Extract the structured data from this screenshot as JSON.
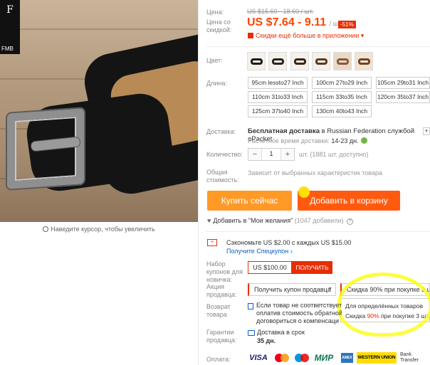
{
  "product_image": {
    "logo_text": "FMB",
    "zoom_hint": "Наведите курсор, чтобы увеличить"
  },
  "price": {
    "label": "Цена:",
    "old": "US $15.60 - 18.60 / шт.",
    "discount_label": "Цена со скидкой:",
    "new": "US $7.64 - 9.11",
    "unit": "/ шт.",
    "discount_badge": "-51%",
    "app_promo": "Скидки ещё больше в приложении"
  },
  "color": {
    "label": "Цвет:",
    "swatches": [
      {
        "name": "color-swatch-1",
        "belt": "#1c1c1c",
        "bg": "#f2efea"
      },
      {
        "name": "color-swatch-2",
        "belt": "#2a2320",
        "bg": "#efe9e0"
      },
      {
        "name": "color-swatch-3",
        "belt": "#3a2418",
        "bg": "#f0ebe4"
      },
      {
        "name": "color-swatch-4",
        "belt": "#5b3a22",
        "bg": "#f2ece4"
      },
      {
        "name": "color-swatch-5",
        "belt": "#8a5a36",
        "bg": "#ead9c8"
      },
      {
        "name": "color-swatch-6",
        "belt": "#6e4527",
        "bg": "#f1e2d2"
      }
    ]
  },
  "length": {
    "label": "Длина:",
    "options": [
      "95cm lessto27 Inch",
      "100cm 27to29 Inch",
      "105cm 29to31 Inch",
      "110cm 31to33 Inch",
      "115cm 33to35 Inch",
      "120cm 35to37 Inch",
      "125cm 37to40 Inch",
      "130cm 40to43 Inch"
    ]
  },
  "shipping": {
    "label": "Доставка:",
    "free": "Бесплатная доставка",
    "dest_prefix": "в",
    "destination": "Russian Federation",
    "service_prefix": "службой",
    "service": "ePacket",
    "eta_label": "Расчётное время доставки:",
    "eta_days": "14-23 дн."
  },
  "quantity": {
    "label": "Количество:",
    "minus": "−",
    "value": "1",
    "plus": "+",
    "available": "шт. (1881 шт. доступно)"
  },
  "total": {
    "label": "Общая стоимость:",
    "note": "Зависит от выбранных характеристик товара"
  },
  "actions": {
    "buy_now": "Купить сейчас",
    "add_to_cart": "Добавить в корзину"
  },
  "wishlist": {
    "text": "Добавить в \"Мои желания\"",
    "count": "(1047 добавили)"
  },
  "promo": {
    "text": "Сэкономьте US $2.00 с каждых US $15.00",
    "link": "Получите Спецкупон"
  },
  "new_user_coupon": {
    "label": "Набор купонов для новичка:",
    "amount": "US $100.00",
    "button": "ПОЛУЧИТЬ"
  },
  "seller_promo": {
    "label": "Акция продавца:",
    "coupon": "Получить купон продавца",
    "deal": "Скидка 90% при покупке 3 шт.",
    "popup_line1": "Для определённых товаров",
    "popup_line2_pre": "Скидка ",
    "popup_line2_pct": "90%",
    "popup_line2_post": " при покупке 3 шт."
  },
  "returns": {
    "label": "Возврат товара",
    "line1": "Если товар не соответствует о",
    "line2": "оплатив стоимость обратной",
    "line3": "договориться о компенсаци"
  },
  "guarantee": {
    "label": "Гарантии продавца:",
    "text": "Доставка в срок",
    "days": "35 дн."
  },
  "payment": {
    "label": "Оплата:",
    "methods": [
      "VISA",
      "Mastercard",
      "Maestro",
      "МИР",
      "AMEX",
      "WESTERN UNION",
      "Bank Transfer"
    ]
  },
  "colors": {
    "accent": "#ff4400",
    "badge_red": "#e62e04",
    "buy_orange": "#ff9a27",
    "cart_orange": "#ff5a0f",
    "link_blue": "#0b5ec9",
    "highlight_yellow": "#fbff1a"
  }
}
